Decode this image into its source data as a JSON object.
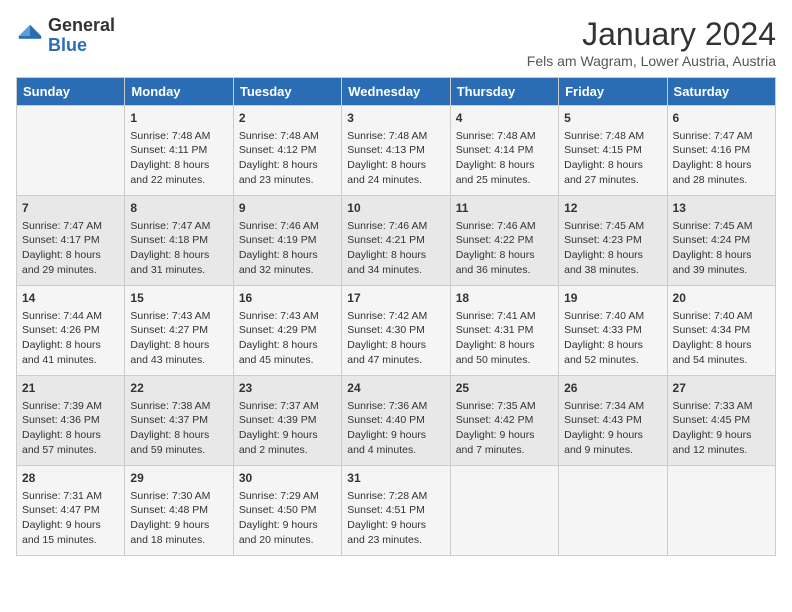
{
  "logo": {
    "general": "General",
    "blue": "Blue"
  },
  "title": "January 2024",
  "subtitle": "Fels am Wagram, Lower Austria, Austria",
  "days_of_week": [
    "Sunday",
    "Monday",
    "Tuesday",
    "Wednesday",
    "Thursday",
    "Friday",
    "Saturday"
  ],
  "weeks": [
    [
      {
        "day": "",
        "info": ""
      },
      {
        "day": "1",
        "info": "Sunrise: 7:48 AM\nSunset: 4:11 PM\nDaylight: 8 hours\nand 22 minutes."
      },
      {
        "day": "2",
        "info": "Sunrise: 7:48 AM\nSunset: 4:12 PM\nDaylight: 8 hours\nand 23 minutes."
      },
      {
        "day": "3",
        "info": "Sunrise: 7:48 AM\nSunset: 4:13 PM\nDaylight: 8 hours\nand 24 minutes."
      },
      {
        "day": "4",
        "info": "Sunrise: 7:48 AM\nSunset: 4:14 PM\nDaylight: 8 hours\nand 25 minutes."
      },
      {
        "day": "5",
        "info": "Sunrise: 7:48 AM\nSunset: 4:15 PM\nDaylight: 8 hours\nand 27 minutes."
      },
      {
        "day": "6",
        "info": "Sunrise: 7:47 AM\nSunset: 4:16 PM\nDaylight: 8 hours\nand 28 minutes."
      }
    ],
    [
      {
        "day": "7",
        "info": "Sunrise: 7:47 AM\nSunset: 4:17 PM\nDaylight: 8 hours\nand 29 minutes."
      },
      {
        "day": "8",
        "info": "Sunrise: 7:47 AM\nSunset: 4:18 PM\nDaylight: 8 hours\nand 31 minutes."
      },
      {
        "day": "9",
        "info": "Sunrise: 7:46 AM\nSunset: 4:19 PM\nDaylight: 8 hours\nand 32 minutes."
      },
      {
        "day": "10",
        "info": "Sunrise: 7:46 AM\nSunset: 4:21 PM\nDaylight: 8 hours\nand 34 minutes."
      },
      {
        "day": "11",
        "info": "Sunrise: 7:46 AM\nSunset: 4:22 PM\nDaylight: 8 hours\nand 36 minutes."
      },
      {
        "day": "12",
        "info": "Sunrise: 7:45 AM\nSunset: 4:23 PM\nDaylight: 8 hours\nand 38 minutes."
      },
      {
        "day": "13",
        "info": "Sunrise: 7:45 AM\nSunset: 4:24 PM\nDaylight: 8 hours\nand 39 minutes."
      }
    ],
    [
      {
        "day": "14",
        "info": "Sunrise: 7:44 AM\nSunset: 4:26 PM\nDaylight: 8 hours\nand 41 minutes."
      },
      {
        "day": "15",
        "info": "Sunrise: 7:43 AM\nSunset: 4:27 PM\nDaylight: 8 hours\nand 43 minutes."
      },
      {
        "day": "16",
        "info": "Sunrise: 7:43 AM\nSunset: 4:29 PM\nDaylight: 8 hours\nand 45 minutes."
      },
      {
        "day": "17",
        "info": "Sunrise: 7:42 AM\nSunset: 4:30 PM\nDaylight: 8 hours\nand 47 minutes."
      },
      {
        "day": "18",
        "info": "Sunrise: 7:41 AM\nSunset: 4:31 PM\nDaylight: 8 hours\nand 50 minutes."
      },
      {
        "day": "19",
        "info": "Sunrise: 7:40 AM\nSunset: 4:33 PM\nDaylight: 8 hours\nand 52 minutes."
      },
      {
        "day": "20",
        "info": "Sunrise: 7:40 AM\nSunset: 4:34 PM\nDaylight: 8 hours\nand 54 minutes."
      }
    ],
    [
      {
        "day": "21",
        "info": "Sunrise: 7:39 AM\nSunset: 4:36 PM\nDaylight: 8 hours\nand 57 minutes."
      },
      {
        "day": "22",
        "info": "Sunrise: 7:38 AM\nSunset: 4:37 PM\nDaylight: 8 hours\nand 59 minutes."
      },
      {
        "day": "23",
        "info": "Sunrise: 7:37 AM\nSunset: 4:39 PM\nDaylight: 9 hours\nand 2 minutes."
      },
      {
        "day": "24",
        "info": "Sunrise: 7:36 AM\nSunset: 4:40 PM\nDaylight: 9 hours\nand 4 minutes."
      },
      {
        "day": "25",
        "info": "Sunrise: 7:35 AM\nSunset: 4:42 PM\nDaylight: 9 hours\nand 7 minutes."
      },
      {
        "day": "26",
        "info": "Sunrise: 7:34 AM\nSunset: 4:43 PM\nDaylight: 9 hours\nand 9 minutes."
      },
      {
        "day": "27",
        "info": "Sunrise: 7:33 AM\nSunset: 4:45 PM\nDaylight: 9 hours\nand 12 minutes."
      }
    ],
    [
      {
        "day": "28",
        "info": "Sunrise: 7:31 AM\nSunset: 4:47 PM\nDaylight: 9 hours\nand 15 minutes."
      },
      {
        "day": "29",
        "info": "Sunrise: 7:30 AM\nSunset: 4:48 PM\nDaylight: 9 hours\nand 18 minutes."
      },
      {
        "day": "30",
        "info": "Sunrise: 7:29 AM\nSunset: 4:50 PM\nDaylight: 9 hours\nand 20 minutes."
      },
      {
        "day": "31",
        "info": "Sunrise: 7:28 AM\nSunset: 4:51 PM\nDaylight: 9 hours\nand 23 minutes."
      },
      {
        "day": "",
        "info": ""
      },
      {
        "day": "",
        "info": ""
      },
      {
        "day": "",
        "info": ""
      }
    ]
  ]
}
